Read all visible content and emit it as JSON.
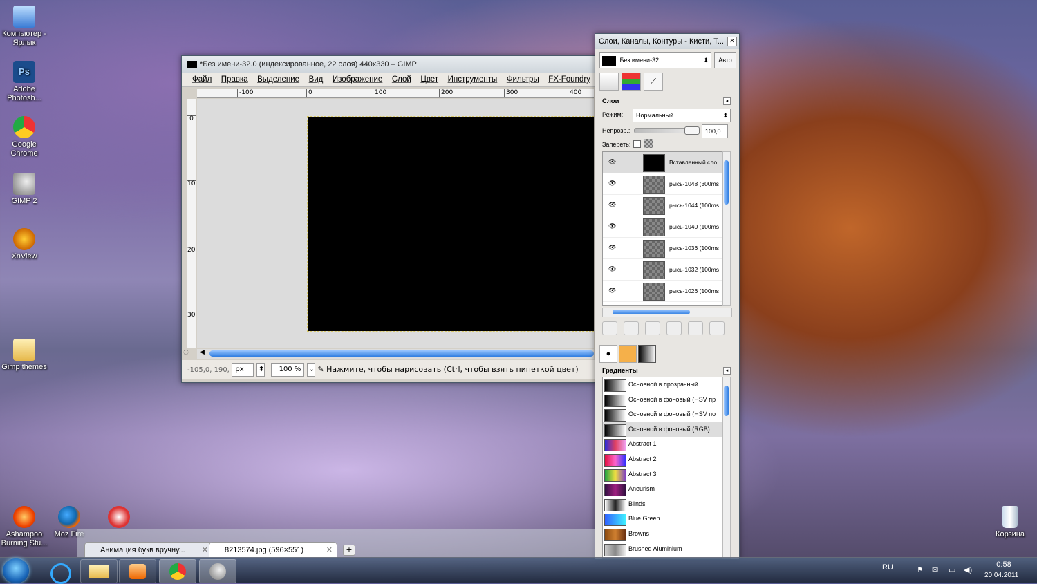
{
  "desktop": {
    "icons": [
      {
        "label": "Компьютер - Ярлык",
        "icon": "computer-icon"
      },
      {
        "label": "Adobe Photosh...",
        "icon": "photoshop-icon"
      },
      {
        "label": "Google Chrome",
        "icon": "chrome-icon"
      },
      {
        "label": "GIMP 2",
        "icon": "gimp-icon"
      },
      {
        "label": "XnView",
        "icon": "xnview-icon"
      },
      {
        "label": "Gimp themes",
        "icon": "folder-icon"
      },
      {
        "label": "Ashampoo Burning Stu...",
        "icon": "ashampoo-icon"
      },
      {
        "label": "Moz Fire",
        "icon": "firefox-icon"
      },
      {
        "label": "Корзина",
        "icon": "recycle-bin-icon"
      }
    ]
  },
  "image_window": {
    "title": "*Без имени-32.0 (индексированное, 22 слоя) 440x330 – GIMP",
    "menu": [
      "Файл",
      "Правка",
      "Выделение",
      "Вид",
      "Изображение",
      "Слой",
      "Цвет",
      "Инструменты",
      "Фильтры",
      "FX-Foundry",
      "Sc"
    ],
    "ruler_h": [
      "-100",
      "0",
      "100",
      "200",
      "300",
      "400"
    ],
    "ruler_v": [
      "0",
      "100",
      "200",
      "300"
    ],
    "status": {
      "coords": "-105,0, 190,",
      "unit": "px",
      "zoom": "100 %",
      "message": "Нажмите, чтобы нарисовать (Ctrl, чтобы взять пипеткой цвет)"
    }
  },
  "dock": {
    "title": "Слои, Каналы, Контуры - Кисти, Т...",
    "image_name": "Без имени-32",
    "auto_label": "Авто",
    "layers_title": "Слои",
    "mode_label": "Режим:",
    "mode_value": "Нормальный",
    "opacity_label": "Непрозр.:",
    "opacity_value": "100,0",
    "lock_label": "Запереть:",
    "layers": [
      "Вставленный сло",
      "рысь-1048 (300ms",
      "рысь-1044 (100ms",
      "рысь-1040 (100ms",
      "рысь-1036 (100ms",
      "рысь-1032 (100ms",
      "рысь-1026 (100ms"
    ],
    "gradients_title": "Градиенты",
    "gradients": [
      {
        "name": "Основной в прозрачный",
        "colors": [
          "#000000",
          "#ffffff"
        ],
        "checker": true
      },
      {
        "name": "Основной в фоновый (HSV пр",
        "colors": [
          "#000000",
          "#ffffff"
        ]
      },
      {
        "name": "Основной в фоновый (HSV по",
        "colors": [
          "#000000",
          "#ffffff"
        ]
      },
      {
        "name": "Основной в фоновый (RGB)",
        "colors": [
          "#000000",
          "#ffffff"
        ]
      },
      {
        "name": "Abstract 1",
        "colors": [
          "#2b2bd8",
          "#e04060",
          "#f0a0f0"
        ]
      },
      {
        "name": "Abstract 2",
        "colors": [
          "#e01040",
          "#ff66cc",
          "#3030ff"
        ]
      },
      {
        "name": "Abstract 3",
        "colors": [
          "#20a040",
          "#f0e040",
          "#8040c0"
        ]
      },
      {
        "name": "Aneurism",
        "colors": [
          "#301040",
          "#a02080",
          "#301040"
        ]
      },
      {
        "name": "Blinds",
        "colors": [
          "#ffffff",
          "#202020",
          "#ffffff"
        ]
      },
      {
        "name": "Blue Green",
        "colors": [
          "#3060ff",
          "#40f0ff"
        ]
      },
      {
        "name": "Browns",
        "colors": [
          "#8a4a10",
          "#d08030",
          "#6a3010"
        ]
      },
      {
        "name": "Brushed Aluminium",
        "colors": [
          "#cccccc",
          "#888888",
          "#eeeeee"
        ]
      }
    ]
  },
  "browser_tabs": [
    {
      "label": "Анимация букв вручну..."
    },
    {
      "label": "8213574.jpg (596×551)"
    }
  ],
  "tray": {
    "lang": "RU",
    "time": "0:58",
    "date": "20.04.2011"
  }
}
